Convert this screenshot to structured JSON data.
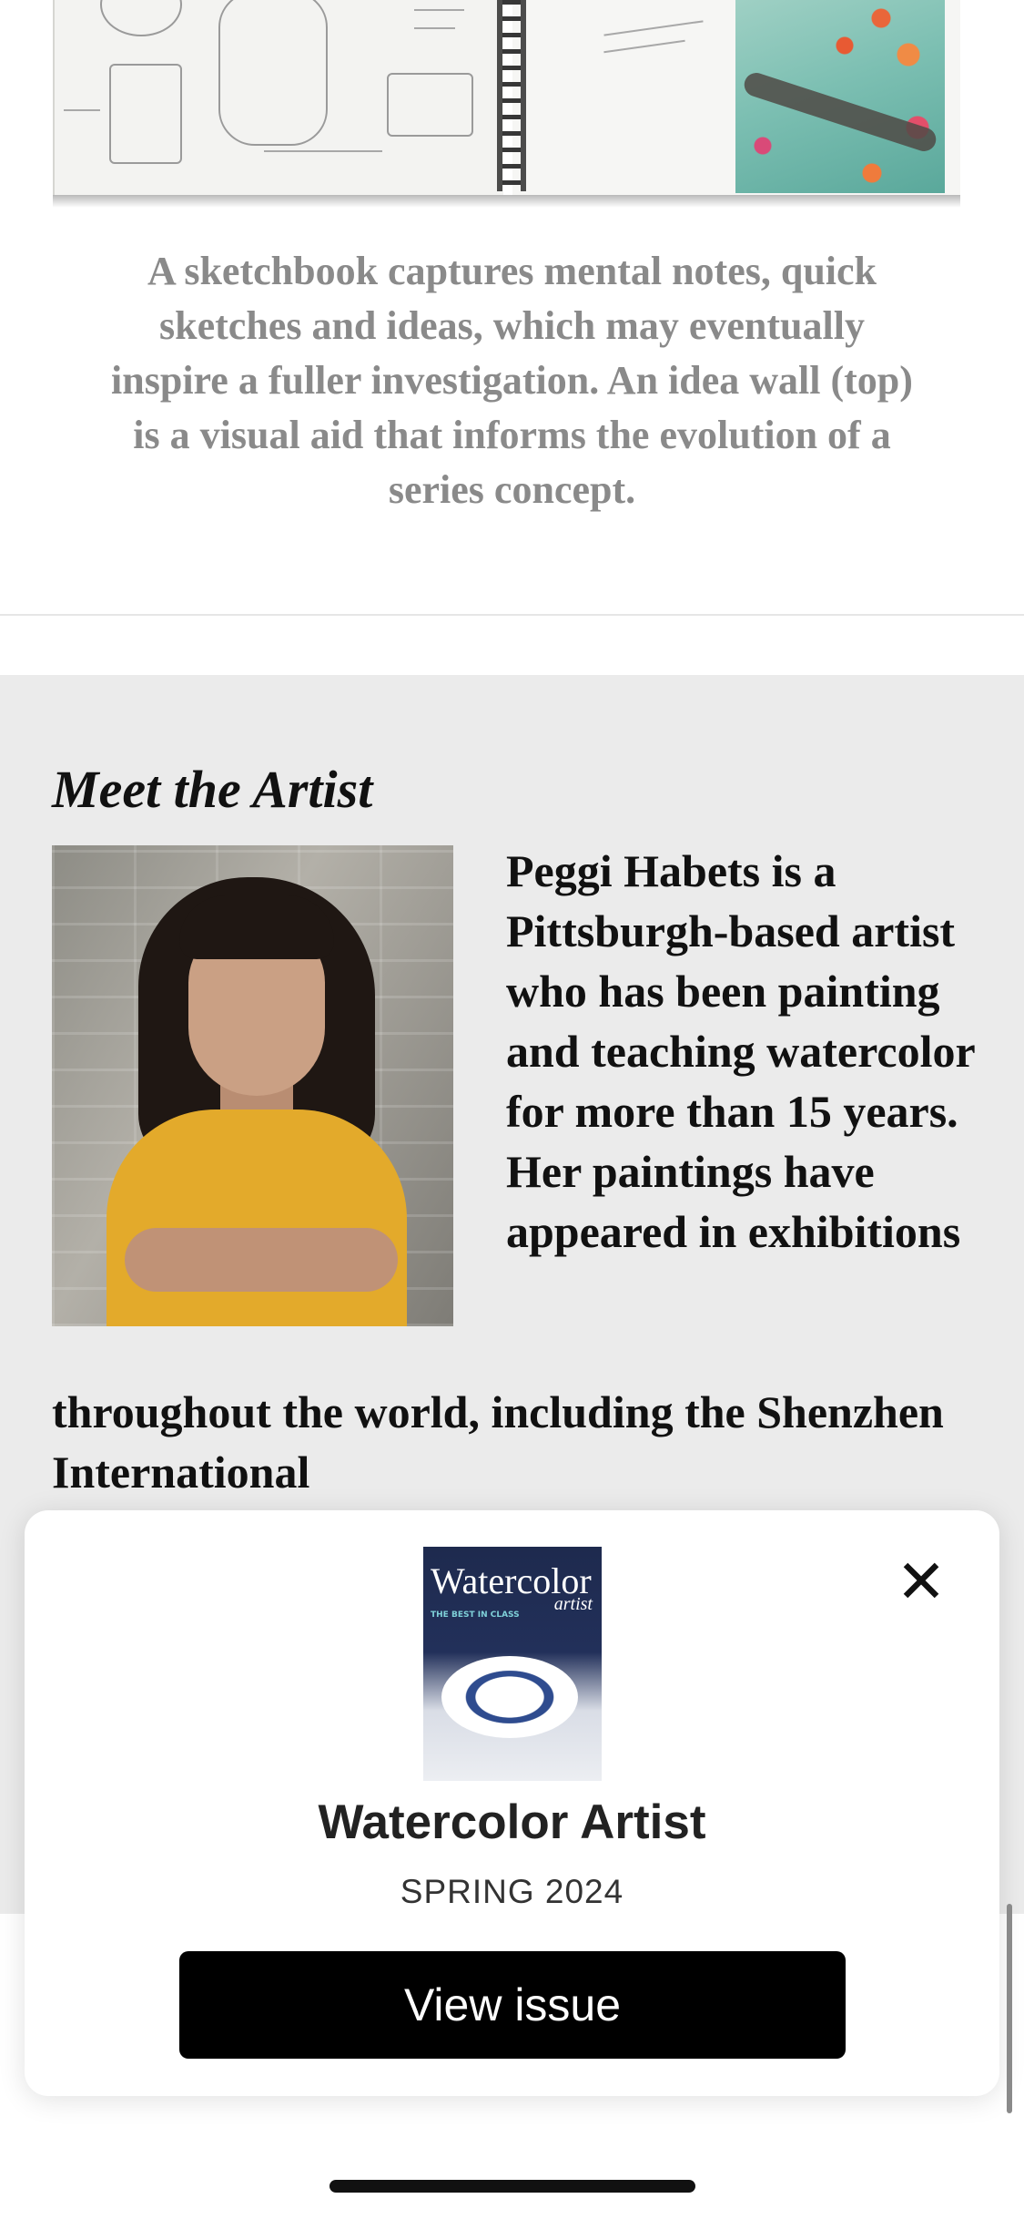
{
  "caption": "A sketchbook captures mental notes, quick sketches and ideas, which may eventually inspire a fuller investigation. An idea wall (top) is a visual aid that informs the evolution of a series concept.",
  "artist": {
    "section_title": "Meet the Artist",
    "bio_side": "Peggi Habets is a Pittsburgh-based artist who has been painting and teaching watercolor for more than 15 years. Her paintings have appeared in exhibitions",
    "bio_wide": "throughout the world, including the Shenzhen International"
  },
  "popup": {
    "cover_title": "Watercolor",
    "cover_subtitle": "artist",
    "cover_tag": "THE BEST IN CLASS",
    "title": "Watercolor Artist",
    "issue": "SPRING 2024",
    "button_label": "View issue",
    "close_icon": "close-icon"
  },
  "colors": {
    "caption_text": "#8a8a8a",
    "section_background": "#ebebeb",
    "button_background": "#000000",
    "shirt": "#e3aa2b"
  }
}
